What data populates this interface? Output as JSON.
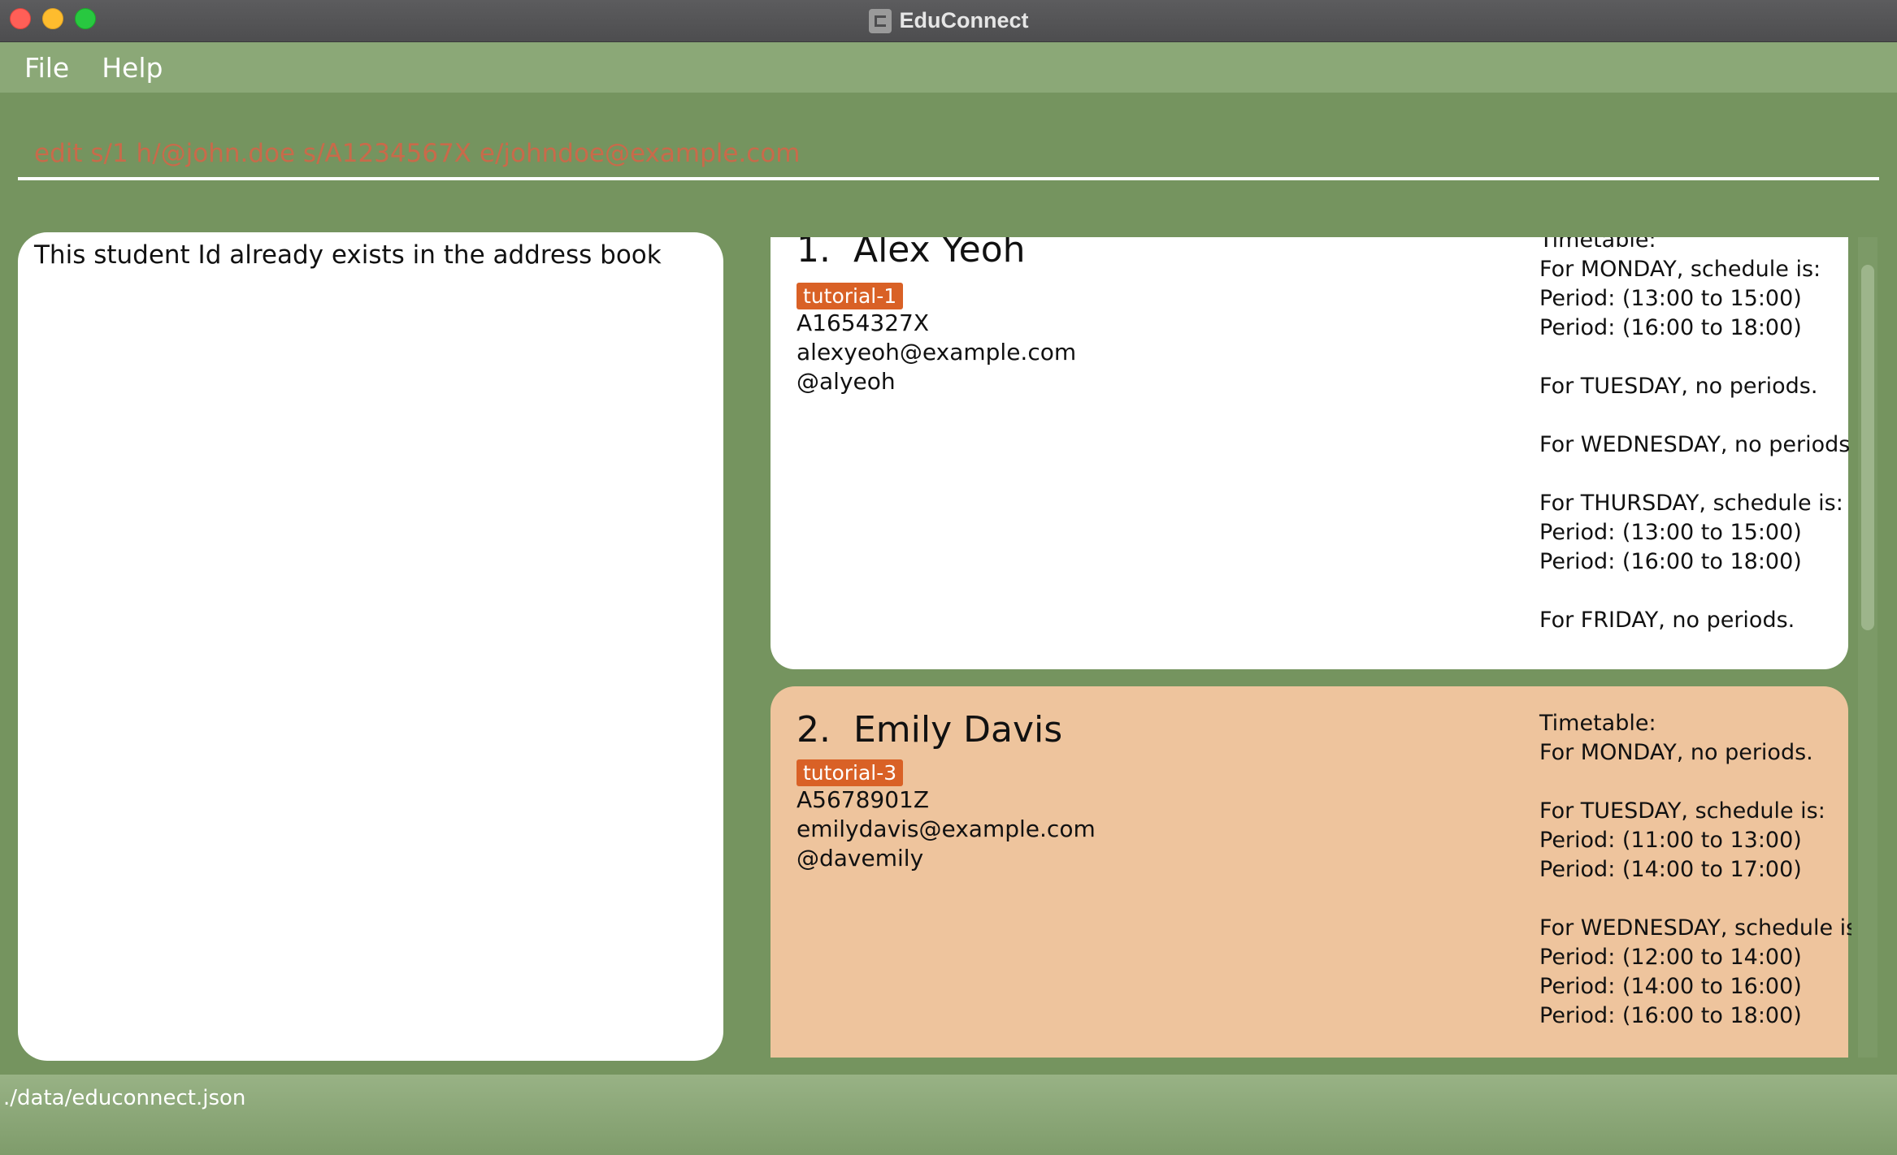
{
  "window": {
    "title": "EduConnect",
    "app_icon": "educonnect-app-icon"
  },
  "menu": {
    "file_label": "File",
    "help_label": "Help"
  },
  "command": {
    "value": "edit s/1 h/@john.doe s/A1234567X e/johndoe@example.com"
  },
  "result": {
    "message": "This student Id already exists in the address book"
  },
  "persons": [
    {
      "index": "1.",
      "name": "Alex Yeoh",
      "tag": "tutorial-1",
      "student_id": "A1654327X",
      "email": "alexyeoh@example.com",
      "telegram": "@alyeoh",
      "timetable": [
        "Timetable:",
        "For MONDAY, schedule is:",
        "Period: (13:00 to 15:00)",
        "Period: (16:00 to 18:00)",
        "",
        "For TUESDAY, no periods.",
        "",
        "For WEDNESDAY, no periods.",
        "",
        "For THURSDAY, schedule is:",
        "Period: (13:00 to 15:00)",
        "Period: (16:00 to 18:00)",
        "",
        "For FRIDAY, no periods."
      ]
    },
    {
      "index": "2.",
      "name": "Emily Davis",
      "tag": "tutorial-3",
      "student_id": "A5678901Z",
      "email": "emilydavis@example.com",
      "telegram": "@davemily",
      "timetable": [
        "Timetable:",
        "For MONDAY, no periods.",
        "",
        "For TUESDAY, schedule is:",
        "Period: (11:00 to 13:00)",
        "Period: (14:00 to 17:00)",
        "",
        "For WEDNESDAY, schedule is:",
        "Period: (12:00 to 14:00)",
        "Period: (14:00 to 16:00)",
        "Period: (16:00 to 18:00)"
      ]
    }
  ],
  "status": {
    "file_path": "./data/educonnect.json"
  },
  "colors": {
    "background": "#75945f",
    "menu_bar": "#8ba877",
    "tag": "#d96126",
    "selected_card": "#eec49d",
    "command_text": "#c96a4a"
  }
}
